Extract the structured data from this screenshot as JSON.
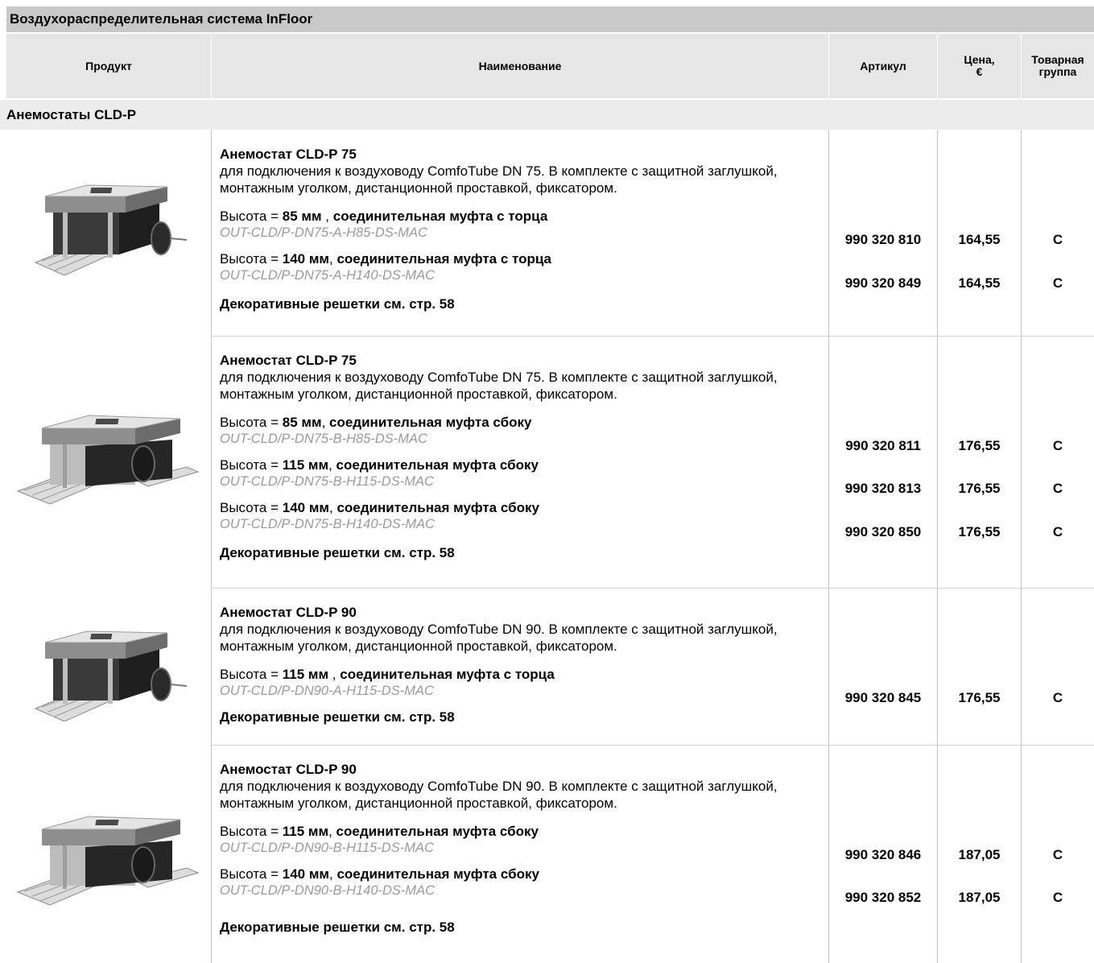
{
  "page_title": "Воздухораспределительная система InFloor",
  "columns": {
    "product": "Продукт",
    "name": "Наименование",
    "article": "Артикул",
    "price_line1": "Цена,",
    "price_line2": "€",
    "group_line1": "Товарная",
    "group_line2": "группа"
  },
  "section_title": "Анемостаты CLD-P",
  "products": [
    {
      "title": "Анемостат CLD-P 75",
      "description": "для подключения к воздуховоду ComfoTube DN 75. В комплекте с защитной заглушкой, монтажным уголком, дистанционной проставкой, фиксатором.",
      "note": "Декоративные решетки см. стр. 58",
      "variants": [
        {
          "prefix": "Высота = ",
          "height": "85 мм",
          "sep": " , ",
          "connection": "соединительная муфта с торца",
          "code": "OUT-CLD/P-DN75-A-H85-DS-MAC",
          "article": "990 320 810",
          "price": "164,55",
          "group": "C"
        },
        {
          "prefix": "Высота = ",
          "height": "140 мм",
          "sep": ", ",
          "connection": "соединительная муфта с торца",
          "code": "OUT-CLD/P-DN75-A-H140-DS-MAC",
          "article": "990 320 849",
          "price": "164,55",
          "group": "C"
        }
      ]
    },
    {
      "title": "Анемостат CLD-P 75",
      "description": "для подключения к воздуховоду ComfoTube DN 75. В комплекте с защитной заглушкой, монтажным уголком, дистанционной проставкой, фиксатором.",
      "note": "Декоративные решетки см. стр. 58",
      "variants": [
        {
          "prefix": "Высота = ",
          "height": "85 мм",
          "sep": ", ",
          "connection": "соединительная муфта сбоку",
          "code": "OUT-CLD/P-DN75-B-H85-DS-MAC",
          "article": "990 320 811",
          "price": "176,55",
          "group": "C"
        },
        {
          "prefix": "Высота = ",
          "height": "115 мм",
          "sep": ", ",
          "connection": "соединительная муфта сбоку",
          "code": "OUT-CLD/P-DN75-B-H115-DS-MAC",
          "article": "990 320 813",
          "price": "176,55",
          "group": "C"
        },
        {
          "prefix": "Высота = ",
          "height": "140 мм",
          "sep": ", ",
          "connection": "соединительная муфта сбоку",
          "code": "OUT-CLD/P-DN75-B-H140-DS-MAC",
          "article": "990 320 850",
          "price": "176,55",
          "group": "C"
        }
      ]
    },
    {
      "title": "Анемостат CLD-P 90",
      "description": "для подключения к воздуховоду ComfoTube DN 90. В комплекте с защитной заглушкой, монтажным уголком, дистанционной проставкой, фиксатором.",
      "note": "Декоративные решетки см. стр. 58",
      "variants": [
        {
          "prefix": "Высота = ",
          "height": "115 мм",
          "sep": " , ",
          "connection": "соединительная муфта с торца",
          "code": "OUT-CLD/P-DN90-A-H115-DS-MAC",
          "article": "990 320 845",
          "price": "176,55",
          "group": "C"
        }
      ]
    },
    {
      "title": "Анемостат CLD-P 90",
      "description": "для подключения к воздуховоду ComfoTube DN 90. В комплекте с защитной заглушкой, монтажным уголком, дистанционной проставкой, фиксатором.",
      "note": "Декоративные решетки см. стр. 58",
      "variants": [
        {
          "prefix": "Высота = ",
          "height": "115 мм",
          "sep": ", ",
          "connection": "соединительная муфта сбоку",
          "code": "OUT-CLD/P-DN90-B-H115-DS-MAC",
          "article": "990 320 846",
          "price": "187,05",
          "group": "C"
        },
        {
          "prefix": "Высота = ",
          "height": "140 мм",
          "sep": ", ",
          "connection": "соединительная муфта сбоку",
          "code": "OUT-CLD/P-DN90-B-H140-DS-MAC",
          "article": "990 320 852",
          "price": "187,05",
          "group": "C"
        }
      ]
    }
  ]
}
